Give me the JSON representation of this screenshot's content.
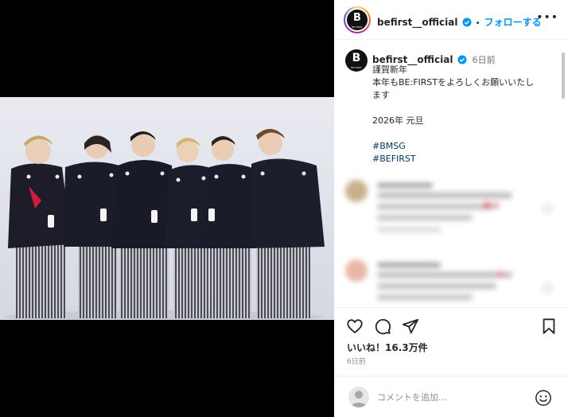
{
  "post": {
    "username": "befirst__official",
    "follow_label": "フォローする",
    "separator": "•",
    "more_label": "•••",
    "logo_text": "B",
    "logo_sub": "BE:FIRST"
  },
  "caption": {
    "username": "befirst__official",
    "age": "6日前",
    "lines": [
      "謹賀新年",
      "本年もBE:FIRSTをよろしくお願いいたし",
      "ます",
      "",
      "2026年 元旦",
      ""
    ],
    "hashtags": [
      "#BMSG",
      "#BEFIRST"
    ]
  },
  "engagement": {
    "likes_label": "いいね！16.3万件",
    "time_label": "6日前"
  },
  "comment": {
    "placeholder": "コメントを追加..."
  },
  "colors": {
    "accent": "#0095f6",
    "hashtag": "#00376b",
    "verified": "#0095f6"
  },
  "icons": [
    "heart-icon",
    "comment-icon",
    "share-icon",
    "bookmark-icon",
    "emoji-icon",
    "verified-icon",
    "more-icon"
  ]
}
